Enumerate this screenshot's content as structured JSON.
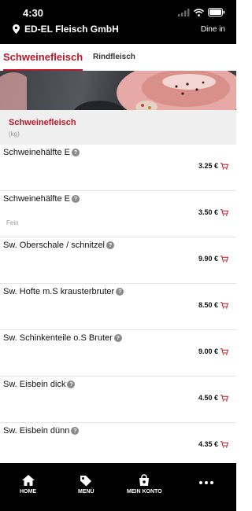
{
  "status": {
    "time": "4:30"
  },
  "header": {
    "location": "ED-EL Fleisch GmbH",
    "mode": "Dine in"
  },
  "tabs": [
    {
      "label": "Schweinefleisch",
      "active": true
    },
    {
      "label": "Rindfleisch",
      "active": false
    }
  ],
  "category": {
    "title": "Schweinefleisch",
    "unit": "(kg)"
  },
  "products": [
    {
      "name": "Schweinehälfte E",
      "note": "",
      "price": "3.25 €"
    },
    {
      "name": "Schweinehälfte E",
      "note": "Fein",
      "price": "3.50 €"
    },
    {
      "name": "Sw. Oberschale / schnitzel",
      "note": "",
      "price": "9.90 €"
    },
    {
      "name": "Sw. Hofte m.S krausterbruter",
      "note": "",
      "price": "8.50 €"
    },
    {
      "name": "Sw. Schinkenteile o.S Bruter",
      "note": "",
      "price": "9.00 €"
    },
    {
      "name": "Sw. Eisbein dick",
      "note": "",
      "price": "4.50 €"
    },
    {
      "name": "Sw. Eisbein dünn",
      "note": "",
      "price": "4.35 €"
    }
  ],
  "nav": [
    {
      "label": "HOME",
      "icon": "home-icon"
    },
    {
      "label": "MENÜ",
      "icon": "tag-icon"
    },
    {
      "label": "MEIN KONTO",
      "icon": "shopping-bag-icon"
    },
    {
      "label": "",
      "icon": "more-icon"
    }
  ],
  "colors": {
    "accent": "#b8182a",
    "header_bg": "#000000",
    "category_bg": "#efefef"
  }
}
